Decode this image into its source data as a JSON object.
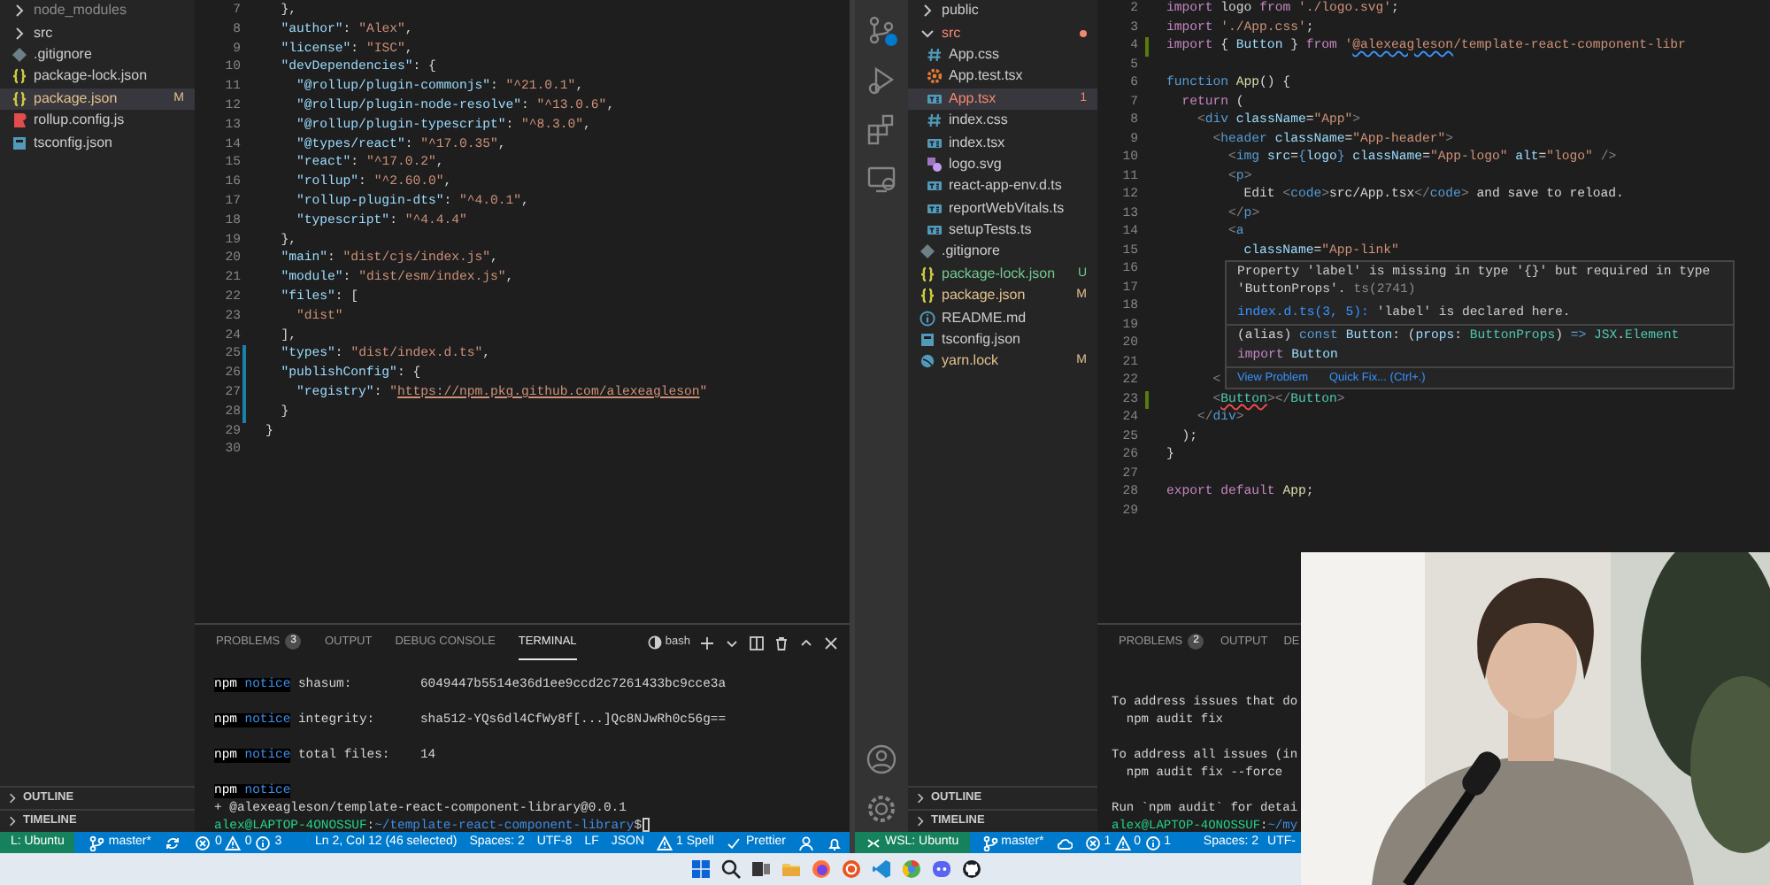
{
  "left_window": {
    "explorer": [
      {
        "kind": "folder",
        "label": "node_modules",
        "expanded": false,
        "selected": false,
        "color": "#8c8c8c"
      },
      {
        "kind": "folder",
        "label": "src",
        "expanded": false,
        "selected": false
      },
      {
        "kind": "git",
        "label": ".gitignore",
        "selected": false
      },
      {
        "kind": "json",
        "label": "package-lock.json",
        "selected": false
      },
      {
        "kind": "json",
        "label": "package.json",
        "selected": true,
        "color": "#e2c08d",
        "badge": "M"
      },
      {
        "kind": "rollup",
        "label": "rollup.config.js",
        "selected": false
      },
      {
        "kind": "tsconfig",
        "label": "tsconfig.json",
        "selected": false
      }
    ],
    "sections": [
      {
        "label": "OUTLINE",
        "expanded": false
      },
      {
        "label": "TIMELINE",
        "expanded": false
      }
    ],
    "editor": [
      {
        "number": "7",
        "tokens": [
          {
            "kind": "p",
            "text": "  },"
          }
        ]
      },
      {
        "number": "8",
        "tokens": [
          {
            "kind": "key",
            "text": "  \"author\""
          },
          {
            "kind": "p",
            "text": ": "
          },
          {
            "kind": "str",
            "text": "\"Alex\""
          },
          {
            "kind": "p",
            "text": ","
          }
        ]
      },
      {
        "number": "9",
        "tokens": [
          {
            "kind": "key",
            "text": "  \"license\""
          },
          {
            "kind": "p",
            "text": ": "
          },
          {
            "kind": "str",
            "text": "\"ISC\""
          },
          {
            "kind": "p",
            "text": ","
          }
        ]
      },
      {
        "number": "10",
        "tokens": [
          {
            "kind": "key",
            "text": "  \"devDependencies\""
          },
          {
            "kind": "p",
            "text": ": {"
          }
        ]
      },
      {
        "number": "11",
        "tokens": [
          {
            "kind": "key",
            "text": "    \"@rollup/plugin-commonjs\""
          },
          {
            "kind": "p",
            "text": ": "
          },
          {
            "kind": "str",
            "text": "\"^21.0.1\""
          },
          {
            "kind": "p",
            "text": ","
          }
        ]
      },
      {
        "number": "12",
        "tokens": [
          {
            "kind": "key",
            "text": "    \"@rollup/plugin-node-resolve\""
          },
          {
            "kind": "p",
            "text": ": "
          },
          {
            "kind": "str",
            "text": "\"^13.0.6\""
          },
          {
            "kind": "p",
            "text": ","
          }
        ]
      },
      {
        "number": "13",
        "tokens": [
          {
            "kind": "key",
            "text": "    \"@rollup/plugin-typescript\""
          },
          {
            "kind": "p",
            "text": ": "
          },
          {
            "kind": "str",
            "text": "\"^8.3.0\""
          },
          {
            "kind": "p",
            "text": ","
          }
        ]
      },
      {
        "number": "14",
        "tokens": [
          {
            "kind": "key",
            "text": "    \"@types/react\""
          },
          {
            "kind": "p",
            "text": ": "
          },
          {
            "kind": "str",
            "text": "\"^17.0.35\""
          },
          {
            "kind": "p",
            "text": ","
          }
        ]
      },
      {
        "number": "15",
        "tokens": [
          {
            "kind": "key",
            "text": "    \"react\""
          },
          {
            "kind": "p",
            "text": ": "
          },
          {
            "kind": "str",
            "text": "\"^17.0.2\""
          },
          {
            "kind": "p",
            "text": ","
          }
        ]
      },
      {
        "number": "16",
        "tokens": [
          {
            "kind": "key",
            "text": "    \"rollup\""
          },
          {
            "kind": "p",
            "text": ": "
          },
          {
            "kind": "str",
            "text": "\"^2.60.0\""
          },
          {
            "kind": "p",
            "text": ","
          }
        ]
      },
      {
        "number": "17",
        "tokens": [
          {
            "kind": "key",
            "text": "    \"rollup-plugin-dts\""
          },
          {
            "kind": "p",
            "text": ": "
          },
          {
            "kind": "str",
            "text": "\"^4.0.1\""
          },
          {
            "kind": "p",
            "text": ","
          }
        ]
      },
      {
        "number": "18",
        "tokens": [
          {
            "kind": "key",
            "text": "    \"typescript\""
          },
          {
            "kind": "p",
            "text": ": "
          },
          {
            "kind": "str",
            "text": "\"^4.4.4\""
          }
        ]
      },
      {
        "number": "19",
        "tokens": [
          {
            "kind": "p",
            "text": "  },"
          }
        ]
      },
      {
        "number": "20",
        "tokens": [
          {
            "kind": "key",
            "text": "  \"main\""
          },
          {
            "kind": "p",
            "text": ": "
          },
          {
            "kind": "str",
            "text": "\"dist/cjs/index.js\""
          },
          {
            "kind": "p",
            "text": ","
          }
        ]
      },
      {
        "number": "21",
        "tokens": [
          {
            "kind": "key",
            "text": "  \"module\""
          },
          {
            "kind": "p",
            "text": ": "
          },
          {
            "kind": "str",
            "text": "\"dist/esm/index.js\""
          },
          {
            "kind": "p",
            "text": ","
          }
        ]
      },
      {
        "number": "22",
        "tokens": [
          {
            "kind": "key",
            "text": "  \"files\""
          },
          {
            "kind": "p",
            "text": ": ["
          }
        ]
      },
      {
        "number": "23",
        "tokens": [
          {
            "kind": "str",
            "text": "    \"dist\""
          }
        ]
      },
      {
        "number": "24",
        "tokens": [
          {
            "kind": "p",
            "text": "  ],"
          }
        ]
      },
      {
        "number": "25",
        "modified": true,
        "tokens": [
          {
            "kind": "key",
            "text": "  \"types\""
          },
          {
            "kind": "p",
            "text": ": "
          },
          {
            "kind": "str",
            "text": "\"dist/index.d.ts\""
          },
          {
            "kind": "p",
            "text": ","
          }
        ]
      },
      {
        "number": "26",
        "modified": true,
        "tokens": [
          {
            "kind": "key",
            "text": "  \"publishConfig\""
          },
          {
            "kind": "p",
            "text": ": {"
          }
        ]
      },
      {
        "number": "27",
        "modified": true,
        "tokens": [
          {
            "kind": "key",
            "text": "    \"registry\""
          },
          {
            "kind": "p",
            "text": ": "
          },
          {
            "kind": "str",
            "text": "\""
          },
          {
            "kind": "link",
            "text": "https://npm.pkg.github.com/alexeagleson"
          },
          {
            "kind": "str",
            "text": "\""
          }
        ]
      },
      {
        "number": "28",
        "modified": true,
        "tokens": [
          {
            "kind": "p",
            "text": "  }"
          }
        ]
      },
      {
        "number": "29",
        "tokens": [
          {
            "kind": "p",
            "text": "}"
          }
        ]
      },
      {
        "number": "30"
      }
    ],
    "panel": {
      "tabs": [
        {
          "label": "PROBLEMS",
          "count": "3",
          "selected": false
        },
        {
          "label": "OUTPUT",
          "selected": false
        },
        {
          "label": "DEBUG CONSOLE",
          "selected": false
        },
        {
          "label": "TERMINAL",
          "selected": true
        }
      ],
      "shell": "bash",
      "tools": [
        {
          "kind": "plus"
        },
        {
          "kind": "chevron-down"
        },
        {
          "kind": "split"
        },
        {
          "kind": "trash"
        },
        {
          "kind": "chevron-up"
        },
        {
          "kind": "close"
        }
      ],
      "terminal": [
        {
          "tokens": [
            {
              "kind": "npm",
              "text": "npm "
            },
            {
              "kind": "notice",
              "text": "notice"
            },
            {
              "kind": "p",
              "text": " shasum:         6049447b5514e36d1ee9ccd2c7261433bc9cce3a"
            }
          ]
        },
        {
          "kind": "blank"
        },
        {
          "tokens": [
            {
              "kind": "npm",
              "text": "npm "
            },
            {
              "kind": "notice",
              "text": "notice"
            },
            {
              "kind": "p",
              "text": " integrity:      sha512-YQs6dl4CfWy8f[...]Qc8NJwRh0c56g=="
            }
          ]
        },
        {
          "kind": "blank"
        },
        {
          "tokens": [
            {
              "kind": "npm",
              "text": "npm "
            },
            {
              "kind": "notice",
              "text": "notice"
            },
            {
              "kind": "p",
              "text": " total files:    14"
            }
          ]
        },
        {
          "kind": "blank"
        },
        {
          "tokens": [
            {
              "kind": "npm",
              "text": "npm "
            },
            {
              "kind": "notice",
              "text": "notice"
            }
          ]
        },
        {
          "tokens": [
            {
              "kind": "p",
              "text": "+ @alexeagleson/template-react-component-library@0.0.1"
            }
          ]
        },
        {
          "tokens": [
            {
              "kind": "user",
              "text": "alex@LAPTOP-4ONOSSUF"
            },
            {
              "kind": "p",
              "text": ":"
            },
            {
              "kind": "path",
              "text": "~/template-react-component-library"
            },
            {
              "kind": "p",
              "text": "$"
            }
          ],
          "cursor": true
        }
      ]
    },
    "status_bar": {
      "left_items": [
        {
          "kind": "remote",
          "label": "L: Ubuntu"
        },
        {
          "kind": "branch",
          "label": "master*"
        },
        {
          "kind": "sync"
        },
        {
          "kind": "problems",
          "errors": "0",
          "warnings": "0",
          "infos": "3"
        }
      ],
      "right_items": [
        {
          "kind": "text",
          "label": "Ln 2, Col 12 (46 selected)"
        },
        {
          "kind": "text",
          "label": "Spaces: 2"
        },
        {
          "kind": "text",
          "label": "UTF-8"
        },
        {
          "kind": "text",
          "label": "LF"
        },
        {
          "kind": "text",
          "label": "JSON"
        },
        {
          "kind": "spell",
          "label": "1 Spell"
        },
        {
          "kind": "prettier",
          "label": "Prettier"
        },
        {
          "kind": "account"
        },
        {
          "kind": "bell"
        }
      ]
    }
  },
  "right_window": {
    "activity_bar": {
      "top": [
        {
          "kind": "source-control"
        },
        {
          "kind": "run-debug"
        },
        {
          "kind": "extensions"
        },
        {
          "kind": "remote-explorer"
        }
      ],
      "bottom": [
        {
          "kind": "account"
        },
        {
          "kind": "settings"
        }
      ]
    },
    "explorer": [
      {
        "kind": "folder",
        "label": "public",
        "expanded": false,
        "selected": false
      },
      {
        "kind": "folder",
        "label": "src",
        "expanded": true,
        "selected": false,
        "color": "#f48771",
        "problem": true,
        "children": [
          {
            "kind": "css",
            "label": "App.css",
            "selected": false
          },
          {
            "kind": "test",
            "label": "App.test.tsx",
            "selected": false
          },
          {
            "kind": "ts",
            "label": "App.tsx",
            "selected": true,
            "color": "#f48771",
            "badge": "1"
          },
          {
            "kind": "css",
            "label": "index.css",
            "selected": false
          },
          {
            "kind": "ts",
            "label": "index.tsx",
            "selected": false
          },
          {
            "kind": "svg",
            "label": "logo.svg",
            "selected": false
          },
          {
            "kind": "ts",
            "label": "react-app-env.d.ts",
            "selected": false
          },
          {
            "kind": "ts",
            "label": "reportWebVitals.ts",
            "selected": false
          },
          {
            "kind": "ts",
            "label": "setupTests.ts",
            "selected": false
          }
        ]
      },
      {
        "kind": "git",
        "label": ".gitignore",
        "selected": false
      },
      {
        "kind": "json",
        "label": "package-lock.json",
        "selected": false,
        "color": "#73c991",
        "badge": "U"
      },
      {
        "kind": "json",
        "label": "package.json",
        "selected": false,
        "color": "#e2c08d",
        "badge": "M"
      },
      {
        "kind": "info",
        "label": "README.md",
        "selected": false
      },
      {
        "kind": "tsconfig",
        "label": "tsconfig.json",
        "selected": false
      },
      {
        "kind": "yarn",
        "label": "yarn.lock",
        "selected": false,
        "color": "#e2c08d",
        "badge": "M"
      }
    ],
    "sections": [
      {
        "label": "OUTLINE",
        "expanded": false
      },
      {
        "label": "TIMELINE",
        "expanded": false
      }
    ],
    "editor": [
      {
        "number": "2",
        "tokens": [
          {
            "kind": "kw",
            "text": "import"
          },
          {
            "kind": "p",
            "text": " logo "
          },
          {
            "kind": "kw",
            "text": "from"
          },
          {
            "kind": "str",
            "text": " './logo.svg'"
          },
          {
            "kind": "p",
            "text": ";"
          }
        ]
      },
      {
        "number": "3",
        "tokens": [
          {
            "kind": "kw",
            "text": "import"
          },
          {
            "kind": "str",
            "text": " './App.css'"
          },
          {
            "kind": "p",
            "text": ";"
          }
        ]
      },
      {
        "number": "4",
        "added": true,
        "tokens": [
          {
            "kind": "kw",
            "text": "import"
          },
          {
            "kind": "p",
            "text": " { "
          },
          {
            "kind": "var",
            "text": "Button"
          },
          {
            "kind": "p",
            "text": " } "
          },
          {
            "kind": "kw",
            "text": "from"
          },
          {
            "kind": "str",
            "text": " '"
          },
          {
            "kind": "squiggle",
            "text": "@alexeagleson"
          },
          {
            "kind": "str",
            "text": "/template-react-component-libr"
          }
        ]
      },
      {
        "number": "5"
      },
      {
        "number": "6",
        "tokens": [
          {
            "kind": "kwb",
            "text": "function"
          },
          {
            "kind": "fn",
            "text": " App"
          },
          {
            "kind": "p",
            "text": "() {"
          }
        ]
      },
      {
        "number": "7",
        "tokens": [
          {
            "kind": "kw",
            "text": "  return"
          },
          {
            "kind": "p",
            "text": " ("
          }
        ]
      },
      {
        "number": "8",
        "tokens": [
          {
            "kind": "br",
            "text": "    <"
          },
          {
            "kind": "tag",
            "text": "div"
          },
          {
            "kind": "attr",
            "text": " className"
          },
          {
            "kind": "p",
            "text": "="
          },
          {
            "kind": "str",
            "text": "\"App\""
          },
          {
            "kind": "br",
            "text": ">"
          }
        ]
      },
      {
        "number": "9",
        "tokens": [
          {
            "kind": "br",
            "text": "      <"
          },
          {
            "kind": "tag",
            "text": "header"
          },
          {
            "kind": "attr",
            "text": " className"
          },
          {
            "kind": "p",
            "text": "="
          },
          {
            "kind": "str",
            "text": "\"App-header\""
          },
          {
            "kind": "br",
            "text": ">"
          }
        ]
      },
      {
        "number": "10",
        "tokens": [
          {
            "kind": "br",
            "text": "        <"
          },
          {
            "kind": "tag",
            "text": "img"
          },
          {
            "kind": "attr",
            "text": " src"
          },
          {
            "kind": "p",
            "text": "="
          },
          {
            "kind": "kwb",
            "text": "{"
          },
          {
            "kind": "var",
            "text": "logo"
          },
          {
            "kind": "kwb",
            "text": "}"
          },
          {
            "kind": "attr",
            "text": " className"
          },
          {
            "kind": "p",
            "text": "="
          },
          {
            "kind": "str",
            "text": "\"App-logo\""
          },
          {
            "kind": "attr",
            "text": " alt"
          },
          {
            "kind": "p",
            "text": "="
          },
          {
            "kind": "str",
            "text": "\"logo\""
          },
          {
            "kind": "br",
            "text": " />"
          }
        ]
      },
      {
        "number": "11",
        "tokens": [
          {
            "kind": "br",
            "text": "        <"
          },
          {
            "kind": "tag",
            "text": "p"
          },
          {
            "kind": "br",
            "text": ">"
          }
        ]
      },
      {
        "number": "12",
        "tokens": [
          {
            "kind": "p",
            "text": "          Edit "
          },
          {
            "kind": "br",
            "text": "<"
          },
          {
            "kind": "tag",
            "text": "code"
          },
          {
            "kind": "br",
            "text": ">"
          },
          {
            "kind": "p",
            "text": "src/App.tsx"
          },
          {
            "kind": "br",
            "text": "</"
          },
          {
            "kind": "tag",
            "text": "code"
          },
          {
            "kind": "br",
            "text": ">"
          },
          {
            "kind": "p",
            "text": " and save to reload."
          }
        ]
      },
      {
        "number": "13",
        "tokens": [
          {
            "kind": "br",
            "text": "        </"
          },
          {
            "kind": "tag",
            "text": "p"
          },
          {
            "kind": "br",
            "text": ">"
          }
        ]
      },
      {
        "number": "14",
        "tokens": [
          {
            "kind": "br",
            "text": "        <"
          },
          {
            "kind": "tag",
            "text": "a"
          }
        ]
      },
      {
        "number": "15",
        "tokens": [
          {
            "kind": "attr",
            "text": "          className"
          },
          {
            "kind": "p",
            "text": "="
          },
          {
            "kind": "str",
            "text": "\"App-link\""
          }
        ]
      },
      {
        "number": "16"
      },
      {
        "number": "17"
      },
      {
        "number": "18"
      },
      {
        "number": "19"
      },
      {
        "number": "20"
      },
      {
        "number": "21"
      },
      {
        "number": "22",
        "tokens": [
          {
            "kind": "br",
            "text": "      <"
          }
        ]
      },
      {
        "number": "23",
        "added": true,
        "tokens": [
          {
            "kind": "br",
            "text": "      <"
          },
          {
            "kind": "err",
            "text": "Button"
          },
          {
            "kind": "br",
            "text": "></"
          },
          {
            "kind": "comp",
            "text": "Button"
          },
          {
            "kind": "br",
            "text": ">"
          }
        ]
      },
      {
        "number": "24",
        "tokens": [
          {
            "kind": "br",
            "text": "    </"
          },
          {
            "kind": "tag",
            "text": "div"
          },
          {
            "kind": "br",
            "text": ">"
          }
        ]
      },
      {
        "number": "25",
        "tokens": [
          {
            "kind": "p",
            "text": "  );"
          }
        ]
      },
      {
        "number": "26",
        "tokens": [
          {
            "kind": "p",
            "text": "}"
          }
        ]
      },
      {
        "number": "27"
      },
      {
        "number": "28",
        "tokens": [
          {
            "kind": "kw",
            "text": "export"
          },
          {
            "kind": "kw",
            "text": " default"
          },
          {
            "kind": "fn",
            "text": " App"
          },
          {
            "kind": "p",
            "text": ";"
          }
        ]
      },
      {
        "number": "29"
      }
    ],
    "hover": {
      "message": "Property 'label' is missing in type '{}' but required in type 'ButtonProps'.",
      "code": "ts(2741)",
      "related_link": "index.d.ts(3, 5):",
      "related_text": "'label' is declared here.",
      "signature": [
        {
          "tokens": [
            {
              "kind": "p",
              "text": "(alias)"
            },
            {
              "kind": "kwb",
              "text": " const"
            },
            {
              "kind": "var",
              "text": " Button"
            },
            {
              "kind": "p",
              "text": ": ("
            },
            {
              "kind": "var",
              "text": "props"
            },
            {
              "kind": "p",
              "text": ": "
            },
            {
              "kind": "comp",
              "text": "ButtonProps"
            },
            {
              "kind": "p",
              "text": ") "
            },
            {
              "kind": "kwb",
              "text": "=>"
            },
            {
              "kind": "comp",
              "text": " JSX"
            },
            {
              "kind": "p",
              "text": "."
            },
            {
              "kind": "comp",
              "text": "Element"
            }
          ]
        },
        {
          "tokens": [
            {
              "kind": "kw",
              "text": "import"
            },
            {
              "kind": "var",
              "text": " Button"
            }
          ]
        }
      ],
      "actions": [
        "View Problem",
        "Quick Fix... (Ctrl+.)"
      ]
    },
    "panel": {
      "tabs": [
        {
          "label": "PROBLEMS",
          "count": "2",
          "selected": false
        },
        {
          "label": "OUTPUT",
          "selected": false
        },
        {
          "label": "DE",
          "selected": false
        }
      ],
      "terminal": [
        {
          "kind": "blank"
        },
        {
          "tokens": [
            {
              "kind": "p",
              "text": "To address issues that do"
            }
          ]
        },
        {
          "tokens": [
            {
              "kind": "p",
              "text": "  npm audit fix"
            }
          ]
        },
        {
          "kind": "blank"
        },
        {
          "tokens": [
            {
              "kind": "p",
              "text": "To address all issues (in"
            }
          ]
        },
        {
          "tokens": [
            {
              "kind": "p",
              "text": "  npm audit fix --force"
            }
          ]
        },
        {
          "kind": "blank"
        },
        {
          "tokens": [
            {
              "kind": "p",
              "text": "Run `npm audit` for detai"
            }
          ]
        },
        {
          "tokens": [
            {
              "kind": "user",
              "text": "alex@LAPTOP-4ONOSSUF"
            },
            {
              "kind": "p",
              "text": ":"
            },
            {
              "kind": "path",
              "text": "~/my"
            }
          ]
        }
      ]
    },
    "status_bar": {
      "left_items": [
        {
          "kind": "remote",
          "label": "WSL: Ubuntu",
          "show_icon": true
        },
        {
          "kind": "branch",
          "label": "master*"
        },
        {
          "kind": "cloud"
        },
        {
          "kind": "problems",
          "errors": "1",
          "warnings": "0",
          "infos": "1"
        }
      ],
      "right_items": [
        {
          "kind": "text",
          "label": "Spaces: 2"
        },
        {
          "kind": "text",
          "label": "UTF-"
        }
      ]
    }
  },
  "taskbar": [
    {
      "kind": "start"
    },
    {
      "kind": "search"
    },
    {
      "kind": "task-view"
    },
    {
      "kind": "folder"
    },
    {
      "kind": "browser"
    },
    {
      "kind": "ring"
    },
    {
      "kind": "ribbon"
    },
    {
      "kind": "chrome"
    },
    {
      "kind": "chat"
    },
    {
      "kind": "cat"
    }
  ]
}
